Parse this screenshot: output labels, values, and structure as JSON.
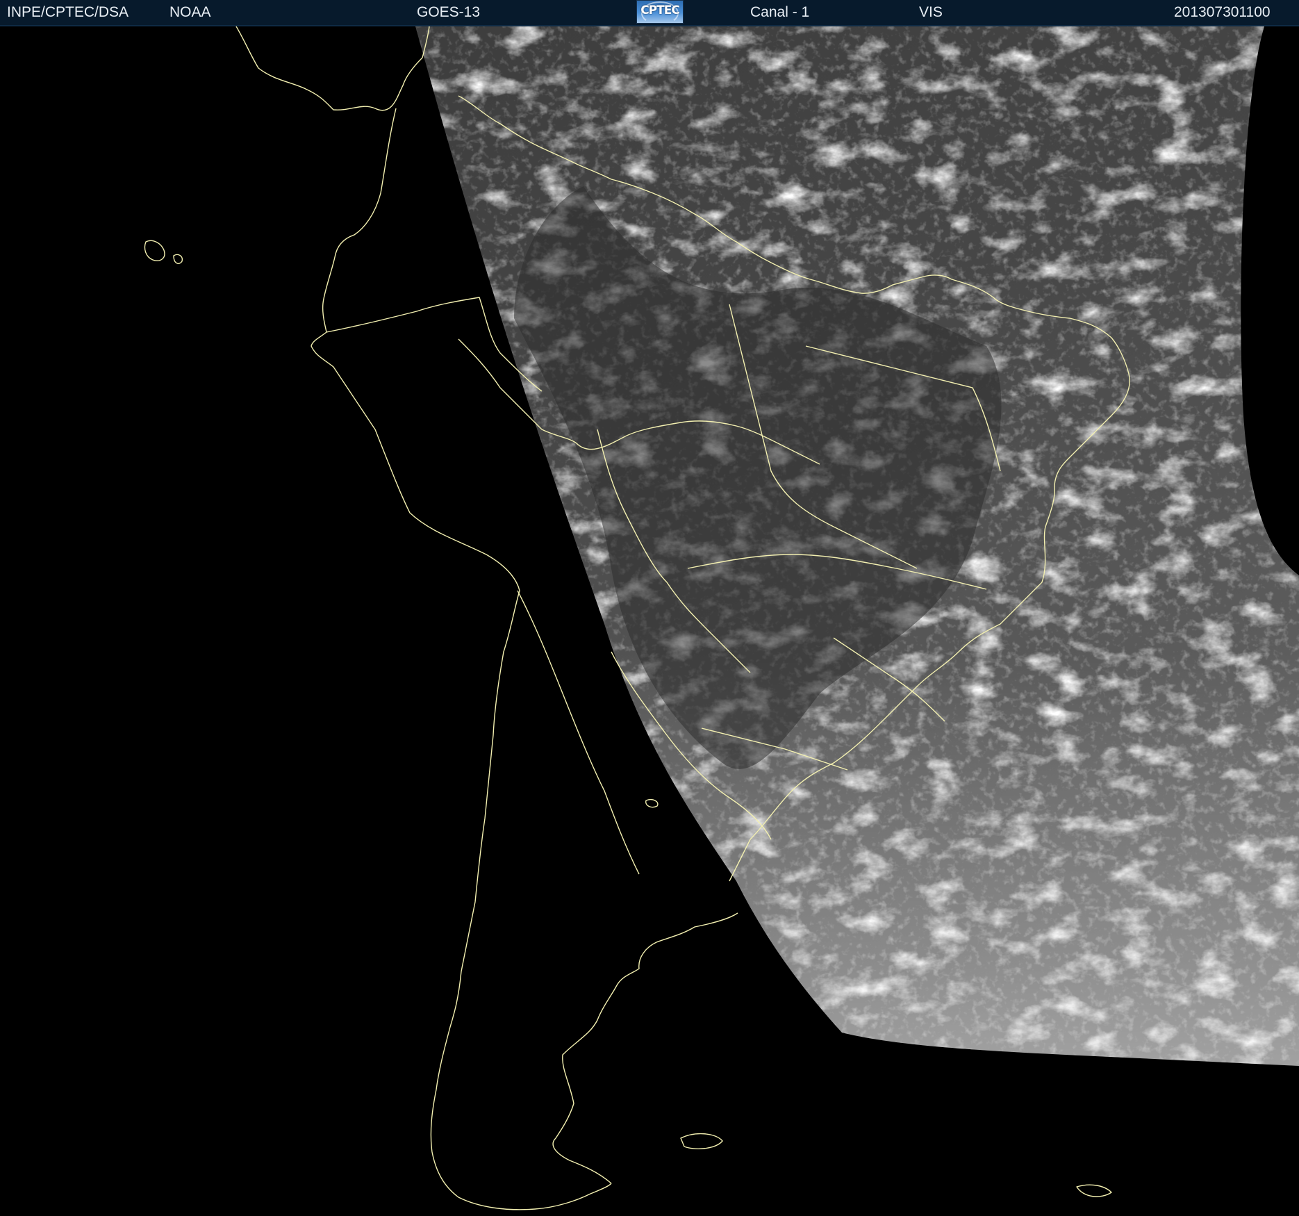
{
  "header": {
    "agency": "INPE/CPTEC/DSA",
    "provider": "NOAA",
    "satellite": "GOES-13",
    "logo_text": "CPTEC",
    "channel": "Canal - 1",
    "band": "VIS",
    "timestamp": "201307301100"
  },
  "map": {
    "region": "South America",
    "background_color": "#000000",
    "coastline_color": "#f2efb0",
    "cloud_color": "#ffffff",
    "surface_color": "#4a4a4a"
  }
}
